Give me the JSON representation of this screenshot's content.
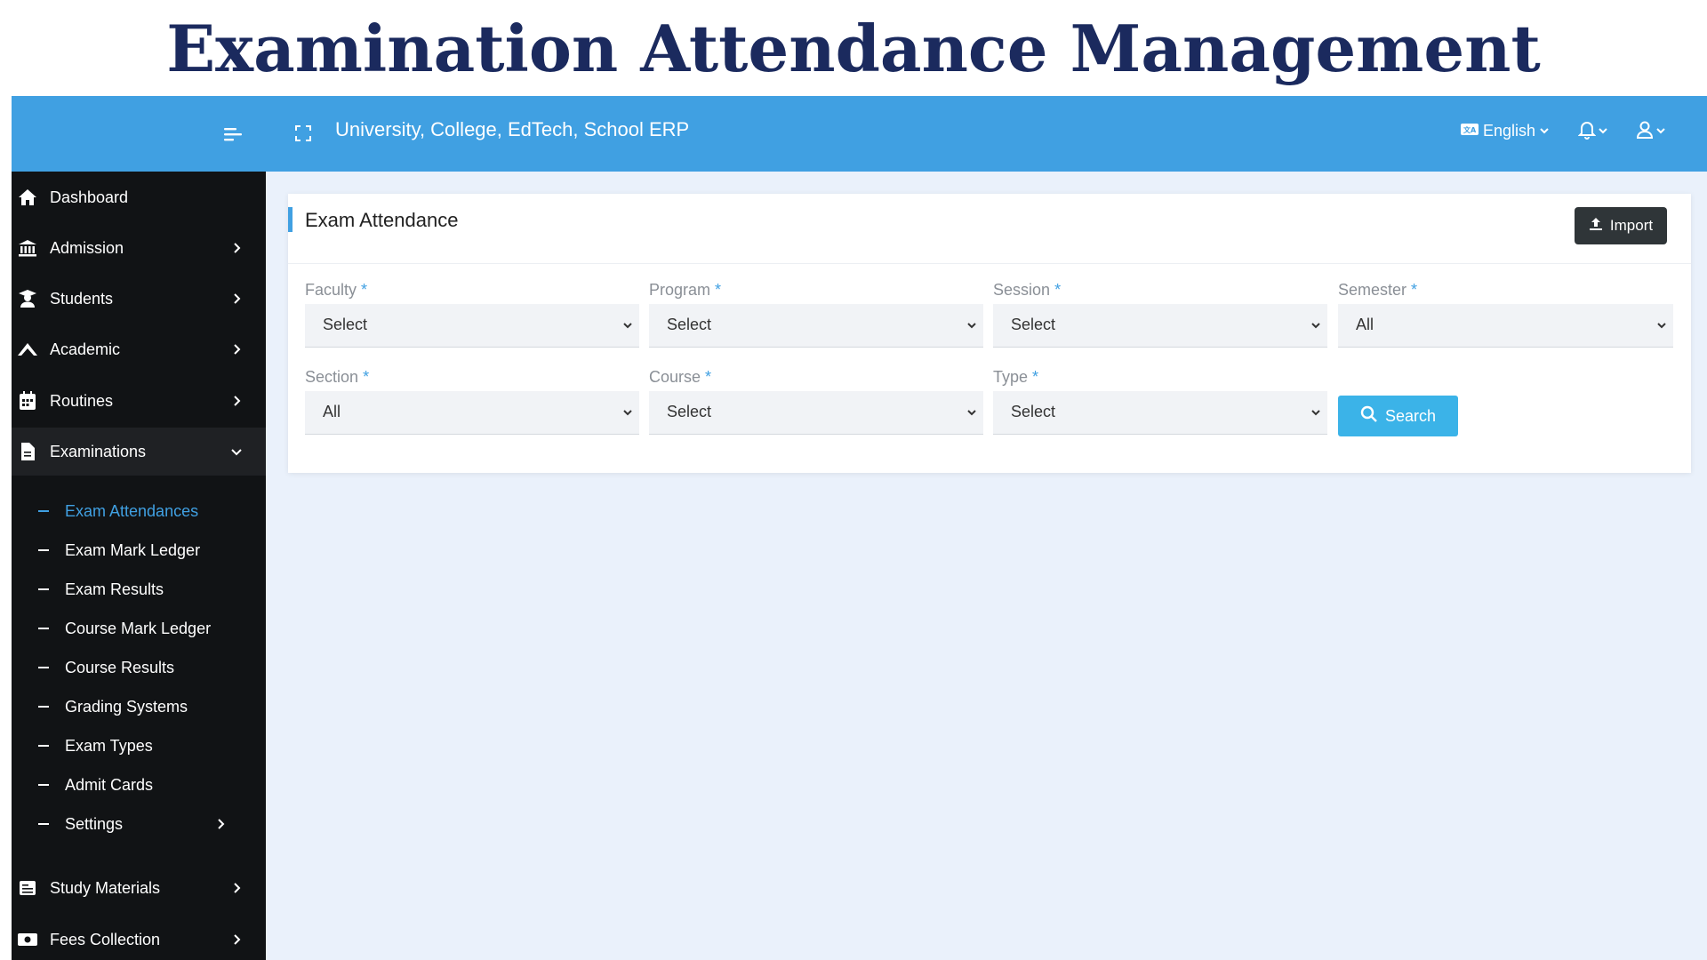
{
  "banner": {
    "title": "Examination Attendance Management"
  },
  "topbar": {
    "app_title": "University, College, EdTech, School ERP",
    "language": "English",
    "icons": [
      "menu-toggle-icon",
      "fullscreen-icon",
      "language-icon",
      "bell-icon",
      "user-icon"
    ]
  },
  "sidebar": {
    "items": [
      {
        "label": "Dashboard",
        "icon": "home-icon"
      },
      {
        "label": "Admission",
        "icon": "bank-icon"
      },
      {
        "label": "Students",
        "icon": "student-icon"
      },
      {
        "label": "Academic",
        "icon": "academic-icon"
      },
      {
        "label": "Routines",
        "icon": "calendar-icon"
      },
      {
        "label": "Examinations",
        "icon": "document-icon"
      },
      {
        "label": "Study Materials",
        "icon": "book-icon"
      },
      {
        "label": "Fees Collection",
        "icon": "money-icon"
      }
    ],
    "examinations_sub": [
      {
        "label": "Exam Attendances"
      },
      {
        "label": "Exam Mark Ledger"
      },
      {
        "label": "Exam Results"
      },
      {
        "label": "Course Mark Ledger"
      },
      {
        "label": "Course Results"
      },
      {
        "label": "Grading Systems"
      },
      {
        "label": "Exam Types"
      },
      {
        "label": "Admit Cards"
      },
      {
        "label": "Settings"
      }
    ]
  },
  "card": {
    "title": "Exam Attendance",
    "import_label": "Import",
    "required_mark": "*",
    "fields": [
      {
        "label": "Faculty",
        "value": "Select"
      },
      {
        "label": "Program",
        "value": "Select"
      },
      {
        "label": "Session",
        "value": "Select"
      },
      {
        "label": "Semester",
        "value": "All"
      },
      {
        "label": "Section",
        "value": "All"
      },
      {
        "label": "Course",
        "value": "Select"
      },
      {
        "label": "Type",
        "value": "Select"
      }
    ],
    "search_label": "Search"
  },
  "colors": {
    "accent": "#40a0e2",
    "sidebar_bg": "#111315",
    "banner_text": "#1b2a5e",
    "search_button": "#3bb3e8",
    "import_button": "#2f3538"
  }
}
